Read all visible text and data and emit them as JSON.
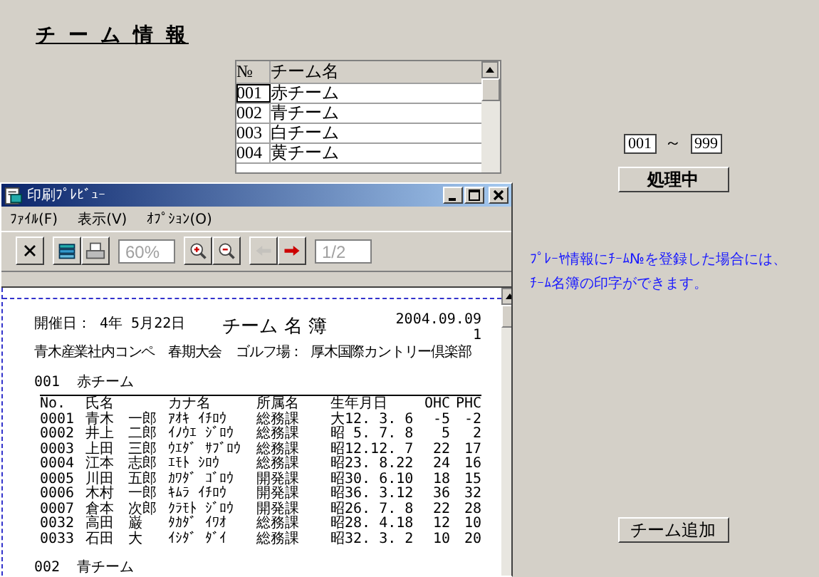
{
  "title": "チ ー ム 情 報",
  "team_table": {
    "columns": [
      "№",
      "チーム名"
    ],
    "rows": [
      {
        "no": "001",
        "name": "赤チーム",
        "selected": true
      },
      {
        "no": "002",
        "name": "青チーム",
        "selected": false
      },
      {
        "no": "003",
        "name": "白チーム",
        "selected": false
      },
      {
        "no": "004",
        "name": "黄チーム",
        "selected": false
      }
    ]
  },
  "range": {
    "from": "001",
    "separator": "～",
    "to": "999"
  },
  "process_button": "処理中",
  "note_lines": [
    "ﾌﾟﾚｰﾔ情報にﾁｰﾑ№を登録した場合には、",
    "ﾁｰﾑ名簿の印字ができます。"
  ],
  "add_button": "チーム追加",
  "preview": {
    "title": "印刷ﾌﾟﾚﾋﾞｭｰ",
    "menu": [
      "ﾌｧｲﾙ(F)",
      "表示(V)",
      "ｵﾌﾟｼｮﾝ(O)"
    ],
    "toolbar_groups": [
      {
        "items": [
          {
            "kind": "close",
            "disabled": false
          }
        ]
      },
      {
        "items": [
          {
            "kind": "page-setup",
            "disabled": false
          },
          {
            "kind": "print",
            "disabled": false
          }
        ]
      },
      {
        "items": [
          {
            "kind": "field",
            "value": "60%",
            "disabled": true
          }
        ]
      },
      {
        "items": [
          {
            "kind": "zoom-in",
            "disabled": false
          },
          {
            "kind": "zoom-out",
            "disabled": false
          }
        ]
      },
      {
        "items": [
          {
            "kind": "prev",
            "disabled": true
          },
          {
            "kind": "next",
            "disabled": false
          }
        ]
      },
      {
        "items": [
          {
            "kind": "field",
            "value": "1/2",
            "disabled": true
          }
        ]
      }
    ],
    "page": {
      "held": "開催日： 4年 5月22日",
      "heading": "チーム 名 簿",
      "date": "2004.09.09",
      "page_no": "1",
      "event": "青木産業社内コンペ　春期大会",
      "course": "ゴルフ場： 厚木国際カントリー倶楽部",
      "columns": [
        "No.",
        "氏名",
        "カナ名",
        "所属名",
        "生年月日",
        "OHC",
        "PHC"
      ],
      "teams": [
        {
          "no": "001",
          "name": "赤チーム",
          "members": [
            {
              "no": "0001",
              "name": "青木　一郎",
              "kana": "ｱｵｷ ｲﾁﾛｳ",
              "dept": "総務課",
              "birth": "大12. 3. 6",
              "ohc": "-5",
              "phc": "-2"
            },
            {
              "no": "0002",
              "name": "井上　二郎",
              "kana": "ｲﾉｳｴ ｼﾞﾛｳ",
              "dept": "総務課",
              "birth": "昭 5. 7. 8",
              "ohc": "5",
              "phc": "2"
            },
            {
              "no": "0003",
              "name": "上田　三郎",
              "kana": "ｳｴﾀﾞ ｻﾌﾞﾛｳ",
              "dept": "総務課",
              "birth": "昭12.12. 7",
              "ohc": "22",
              "phc": "17"
            },
            {
              "no": "0004",
              "name": "江本　志郎",
              "kana": "ｴﾓﾄ ｼﾛｳ",
              "dept": "総務課",
              "birth": "昭23. 8.22",
              "ohc": "24",
              "phc": "16"
            },
            {
              "no": "0005",
              "name": "川田　五郎",
              "kana": "ｶﾜﾀﾞ ｺﾞﾛｳ",
              "dept": "開発課",
              "birth": "昭30. 6.10",
              "ohc": "18",
              "phc": "15"
            },
            {
              "no": "0006",
              "name": "木村　一郎",
              "kana": "ｷﾑﾗ ｲﾁﾛｳ",
              "dept": "開発課",
              "birth": "昭36. 3.12",
              "ohc": "36",
              "phc": "32"
            },
            {
              "no": "0007",
              "name": "倉本　次郎",
              "kana": "ｸﾗﾓﾄ ｼﾞﾛｳ",
              "dept": "開発課",
              "birth": "昭26. 7. 8",
              "ohc": "22",
              "phc": "28"
            },
            {
              "no": "0032",
              "name": "高田　巌",
              "kana": "ﾀｶﾀﾞ ｲﾜｵ",
              "dept": "総務課",
              "birth": "昭28. 4.18",
              "ohc": "12",
              "phc": "10"
            },
            {
              "no": "0033",
              "name": "石田　大",
              "kana": "ｲｼﾀﾞ ﾀﾞｲ",
              "dept": "総務課",
              "birth": "昭32. 3. 2",
              "ohc": "10",
              "phc": "20"
            }
          ]
        },
        {
          "no": "002",
          "name": "青チーム"
        }
      ]
    }
  }
}
